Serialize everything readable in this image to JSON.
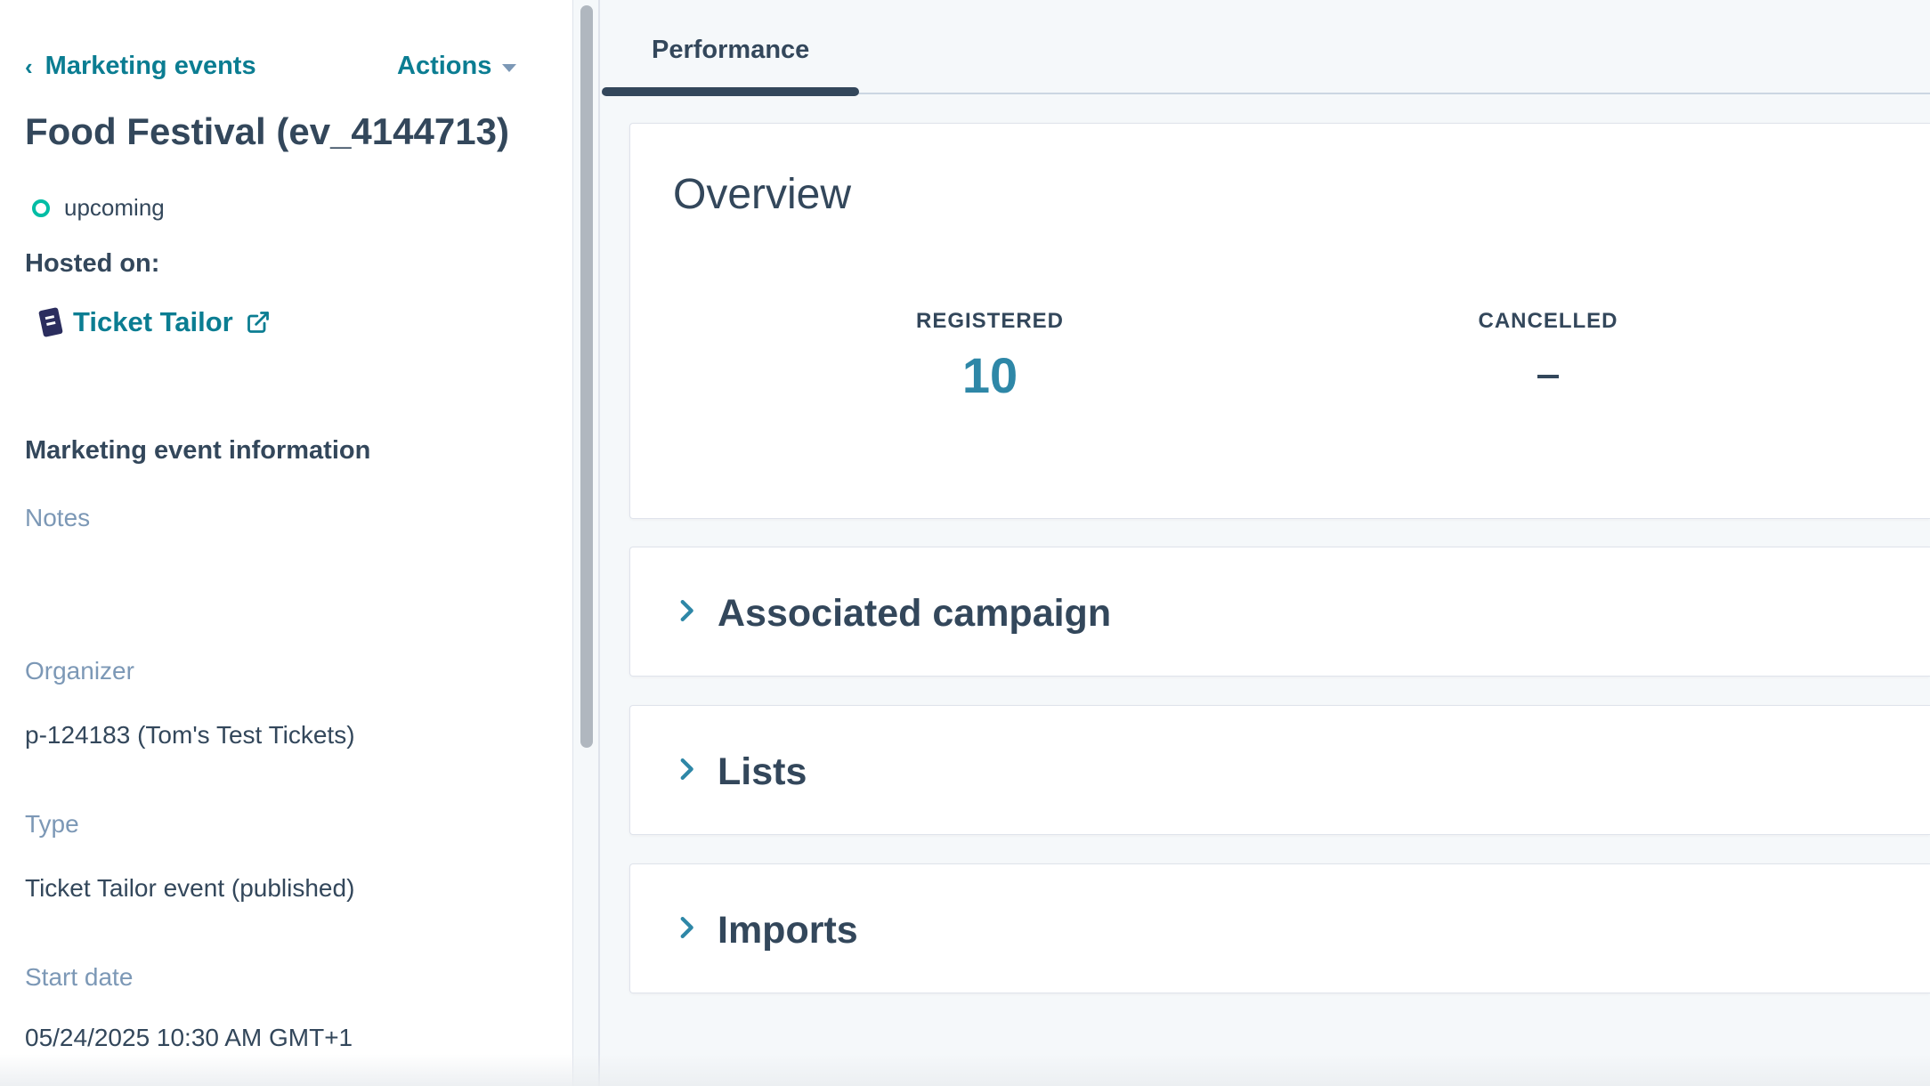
{
  "sidebar": {
    "back_label": "Marketing events",
    "actions_label": "Actions",
    "event_title": "Food Festival (ev_4144713)",
    "status": "upcoming",
    "hosted_on_label": "Hosted on:",
    "host_name": "Ticket Tailor",
    "section_title": "Marketing event information",
    "fields": [
      {
        "label": "Notes",
        "value": ""
      },
      {
        "label": "Organizer",
        "value": "p-124183 (Tom's Test Tickets)"
      },
      {
        "label": "Type",
        "value": "Ticket Tailor event (published)"
      },
      {
        "label": "Start date",
        "value": "05/24/2025 10:30 AM GMT+1"
      }
    ]
  },
  "main": {
    "tabs": [
      {
        "label": "Performance",
        "active": true
      }
    ],
    "overview": {
      "title": "Overview",
      "metrics": [
        {
          "label": "REGISTERED",
          "value": "10"
        },
        {
          "label": "CANCELLED",
          "value": ""
        }
      ]
    },
    "sections": [
      {
        "title": "Associated campaign"
      },
      {
        "title": "Lists"
      },
      {
        "title": "Imports"
      }
    ]
  },
  "icons": {
    "back": "chevron-left-icon",
    "actions_caret": "caret-down-icon",
    "status": "status-ring-icon",
    "host_logo": "ticket-tailor-logo",
    "external": "external-link-icon",
    "expand": "chevron-right-icon"
  },
  "colors": {
    "link": "#0b7d92",
    "text": "#33475b",
    "muted": "#7c98b6",
    "metric": "#2e87a7",
    "status_ring": "#00bda5"
  }
}
